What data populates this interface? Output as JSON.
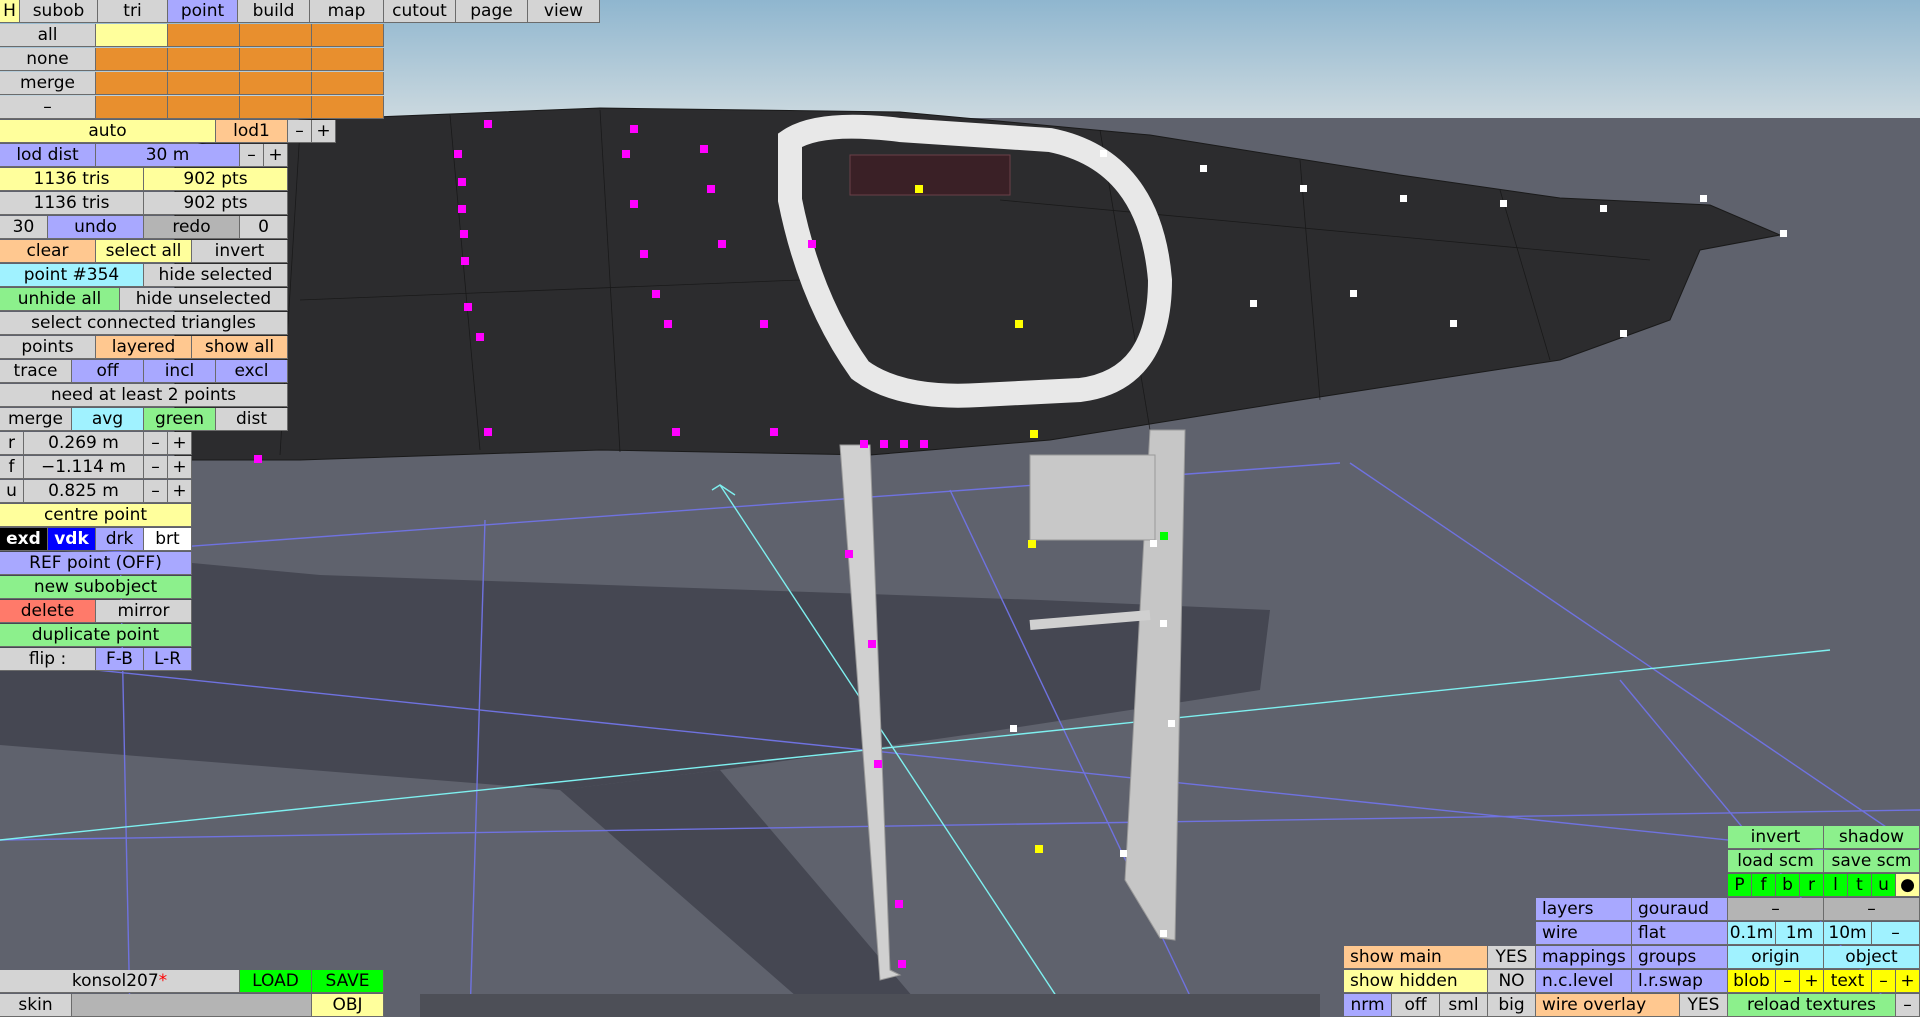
{
  "top_menu": {
    "h": "H",
    "items": [
      "subob",
      "tri",
      "point",
      "build",
      "map",
      "cutout",
      "page",
      "view"
    ],
    "active": "point"
  },
  "select_rows": [
    "all",
    "none",
    "merge",
    "–"
  ],
  "lod": {
    "auto": "auto",
    "name": "lod1",
    "minus": "–",
    "plus": "+",
    "dist_label": "lod dist",
    "dist_value": "30 m"
  },
  "stats": {
    "tris1": "1136 tris",
    "pts1": "902 pts",
    "tris2": "1136 tris",
    "pts2": "902 pts"
  },
  "history": {
    "count": "30",
    "undo": "undo",
    "redo": "redo",
    "redo_count": "0"
  },
  "selection": {
    "clear": "clear",
    "select_all": "select all",
    "invert": "invert"
  },
  "point": {
    "current": "point #354",
    "hide_selected": "hide selected",
    "unhide_all": "unhide all",
    "hide_unselected": "hide unselected",
    "select_connected": "select connected triangles"
  },
  "display": {
    "points": "points",
    "layered": "layered",
    "show_all": "show all"
  },
  "trace": {
    "label": "trace",
    "off": "off",
    "incl": "incl",
    "excl": "excl"
  },
  "status_msg": "need at least 2 points",
  "merge_row": {
    "merge": "merge",
    "avg": "avg",
    "green": "green",
    "dist": "dist"
  },
  "coords": [
    {
      "axis": "r",
      "value": "0.269 m"
    },
    {
      "axis": "f",
      "value": "−1.114 m"
    },
    {
      "axis": "u",
      "value": "0.825 m"
    }
  ],
  "coord_minus": "–",
  "coord_plus": "+",
  "centre_point": "centre point",
  "shade": {
    "exd": "exd",
    "vdk": "vdk",
    "drk": "drk",
    "brt": "brt"
  },
  "ref_point": "REF point (OFF)",
  "new_subobject": "new subobject",
  "delete": "delete",
  "mirror": "mirror",
  "duplicate_point": "duplicate point",
  "flip": {
    "label": "flip :",
    "fb": "F-B",
    "lr": "L-R"
  },
  "file": {
    "name": "konsol207",
    "modified": "*",
    "load": "LOAD",
    "save": "SAVE",
    "skin": "skin",
    "obj": "OBJ"
  },
  "bottom_left_panel": {
    "show_main": "show main",
    "show_main_val": "YES",
    "show_hidden": "show hidden",
    "show_hidden_val": "NO",
    "nrm": "nrm",
    "off": "off",
    "sml": "sml",
    "big": "big"
  },
  "bottom_mid_panel": {
    "layers": "layers",
    "gouraud": "gouraud",
    "wire": "wire",
    "flat": "flat",
    "mappings": "mappings",
    "groups": "groups",
    "nclevel": "n.c.level",
    "lrswap": "l.r.swap",
    "wire_overlay": "wire overlay",
    "wire_overlay_val": "YES"
  },
  "bottom_right_panel": {
    "invert": "invert",
    "shadow": "shadow",
    "load_scm": "load scm",
    "save_scm": "save scm",
    "views": [
      "P",
      "f",
      "b",
      "r",
      "l",
      "t",
      "u",
      "●"
    ],
    "dash1": "–",
    "dash2": "–",
    "grid": [
      "0.1m",
      "1m",
      "10m",
      "–"
    ],
    "origin": "origin",
    "object": "object",
    "blob": "blob",
    "blob_minus": "–",
    "blob_plus": "+",
    "text": "text",
    "text_minus": "–",
    "text_plus": "+",
    "reload_textures": "reload textures",
    "reload_minus": "–"
  },
  "colors": {
    "sky_top": "#8fb6cf",
    "sky_bottom": "#c9d7df",
    "ground": "#5e616c",
    "mesh": "#2a2a2a",
    "selected_point": "#ff00ff",
    "point": "#ffffff",
    "active_point": "#ffff00"
  }
}
